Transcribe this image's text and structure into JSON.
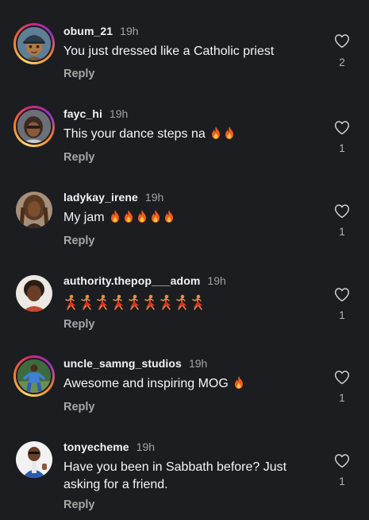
{
  "comments": [
    {
      "username": "obum_21",
      "time": "19h",
      "text": "You just dressed like a Catholic priest",
      "emojis": [],
      "reply_label": "Reply",
      "likes": "2",
      "avatar_icon": "cartoon-boy-cap-avatar",
      "story_ring": true
    },
    {
      "username": "fayc_hi",
      "time": "19h",
      "text": "This your dance steps na",
      "emojis": [
        "fire",
        "fire"
      ],
      "reply_label": "Reply",
      "likes": "1",
      "avatar_icon": "woman-selfie-avatar",
      "story_ring": true
    },
    {
      "username": "ladykay_irene",
      "time": "19h",
      "text": "My jam",
      "emojis": [
        "fire",
        "fire",
        "fire",
        "fire",
        "fire"
      ],
      "reply_label": "Reply",
      "likes": "1",
      "avatar_icon": "woman-braids-avatar",
      "story_ring": false
    },
    {
      "username": "authority.thepop___adom",
      "time": "19h",
      "text": "",
      "emojis": [
        "dancer",
        "dancer",
        "dancer",
        "dancer",
        "dancer",
        "dancer",
        "dancer",
        "dancer",
        "dancer"
      ],
      "reply_label": "Reply",
      "likes": "1",
      "avatar_icon": "woman-portrait-avatar",
      "story_ring": false
    },
    {
      "username": "uncle_samng_studios",
      "time": "19h",
      "text": "Awesome and inspiring MOG",
      "emojis": [
        "fire"
      ],
      "reply_label": "Reply",
      "likes": "1",
      "avatar_icon": "man-blue-outfit-avatar",
      "story_ring": true
    },
    {
      "username": "tonyecheme",
      "time": "19h",
      "text": "Have you been in Sabbath before? Just asking for a friend.",
      "emojis": [],
      "reply_label": "Reply",
      "likes": "1",
      "avatar_icon": "man-thumbs-up-avatar",
      "story_ring": false
    }
  ],
  "colors": {
    "background": "#1b1d21",
    "username": "#f3f3f3",
    "meta": "#a3a3a3",
    "heart_outline": "#d0d0d0"
  }
}
